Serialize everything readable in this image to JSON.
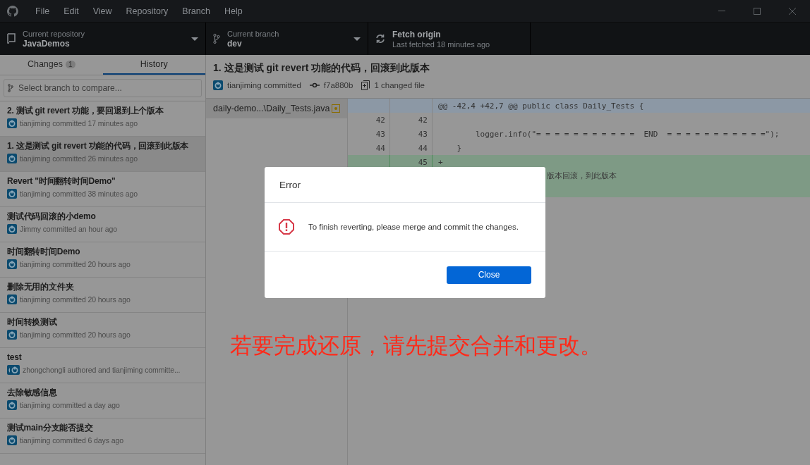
{
  "menu": [
    "File",
    "Edit",
    "View",
    "Repository",
    "Branch",
    "Help"
  ],
  "toolbar": {
    "repository": {
      "label": "Current repository",
      "value": "JavaDemos"
    },
    "branch": {
      "label": "Current branch",
      "value": "dev"
    },
    "fetch": {
      "label": "Fetch origin",
      "sub": "Last fetched 18 minutes ago"
    }
  },
  "tabs": [
    {
      "label": "Changes",
      "count": "1",
      "selected": false
    },
    {
      "label": "History",
      "selected": true
    }
  ],
  "branch_filter": {
    "placeholder": "Select branch to compare..."
  },
  "commits": [
    {
      "title": "2. 测试 git revert 功能，要回退到上个版本",
      "meta": "tianjiming committed 17 minutes ago",
      "selected": false,
      "co_authored": false
    },
    {
      "title": "1. 这是测试 git revert 功能的代码，回滚到此版本",
      "meta": "tianjiming committed 26 minutes ago",
      "selected": true,
      "co_authored": false
    },
    {
      "title": "Revert \"时间翻转时间Demo\"",
      "meta": "tianjiming committed 38 minutes ago",
      "selected": false,
      "co_authored": false
    },
    {
      "title": "测试代码回滚的小demo",
      "meta": "Jimmy committed an hour ago",
      "selected": false,
      "co_authored": false
    },
    {
      "title": "时间翻转时间Demo",
      "meta": "tianjiming committed 20 hours ago",
      "selected": false,
      "co_authored": false
    },
    {
      "title": "删除无用的文件夹",
      "meta": "tianjiming committed 20 hours ago",
      "selected": false,
      "co_authored": false
    },
    {
      "title": "时间转换测试",
      "meta": "tianjiming committed 20 hours ago",
      "selected": false,
      "co_authored": false
    },
    {
      "title": "test",
      "meta": "zhongchongli authored and tianjiming committe...",
      "selected": false,
      "co_authored": true
    },
    {
      "title": "去除敏感信息",
      "meta": "tianjiming committed a day ago",
      "selected": false,
      "co_authored": false
    },
    {
      "title": "测试main分支能否提交",
      "meta": "tianjiming committed 6 days ago",
      "selected": false,
      "co_authored": false
    }
  ],
  "commit": {
    "title": "1. 这是测试 git revert 功能的代码，回滚到此版本",
    "author": "tianjiming committed",
    "sha": "f7a880b",
    "files_changed": "1 changed file"
  },
  "files": [
    {
      "path": "daily-demo...\\Daily_Tests.java",
      "selected": true
    }
  ],
  "diff": [
    {
      "kind": "hunk",
      "code": "@@ -42,4 +42,7 @@ public class Daily_Tests {"
    },
    {
      "kind": "context",
      "old": "42",
      "new": "42"
    },
    {
      "kind": "context",
      "old": "43",
      "new": "43",
      "code": "        logger.info(\"= = = = = = = = = = =  END  = = = = = = = = = = =\");"
    },
    {
      "kind": "context",
      "old": "44",
      "new": "44",
      "code": "    }"
    },
    {
      "kind": "added",
      "new": "45",
      "code": "+"
    },
    {
      "kind": "added-hidden",
      "code": "版本回滚，到此版本"
    },
    {
      "kind": "added-hidden"
    }
  ],
  "dialog": {
    "title": "Error",
    "message": "To finish reverting, please merge and commit the changes.",
    "button": "Close"
  },
  "annotation": "若要完成还原，请先提交合并和更改。"
}
